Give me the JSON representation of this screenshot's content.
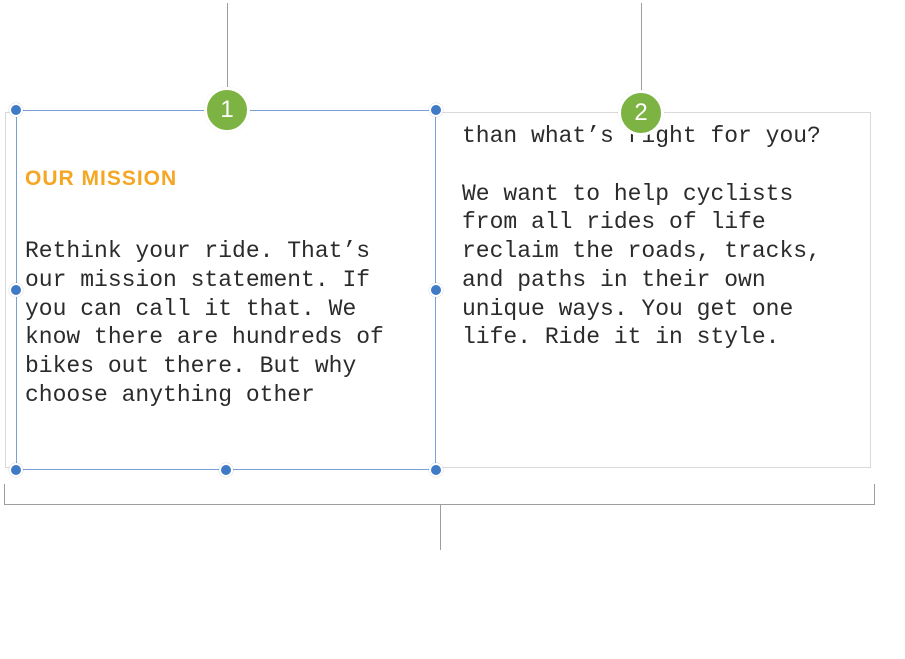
{
  "callouts": {
    "c1": "1",
    "c2": "2"
  },
  "leftBox": {
    "heading": "OUR MISSION",
    "paragraph": "Rethink your ride. That’s our mission statement. If you can call it that. We know there are hundreds of bikes out there. But why choose anything other"
  },
  "rightBox": {
    "paragraph": "than what’s right for you?\n\nWe want to help cyclists from all rides of life reclaim the roads, tracks, and paths in their own unique ways. You get one life. Ride it in style."
  },
  "colors": {
    "headingColor": "#F5A623",
    "badgeColor": "#7CB342",
    "handleColor": "#3e7ac6"
  }
}
